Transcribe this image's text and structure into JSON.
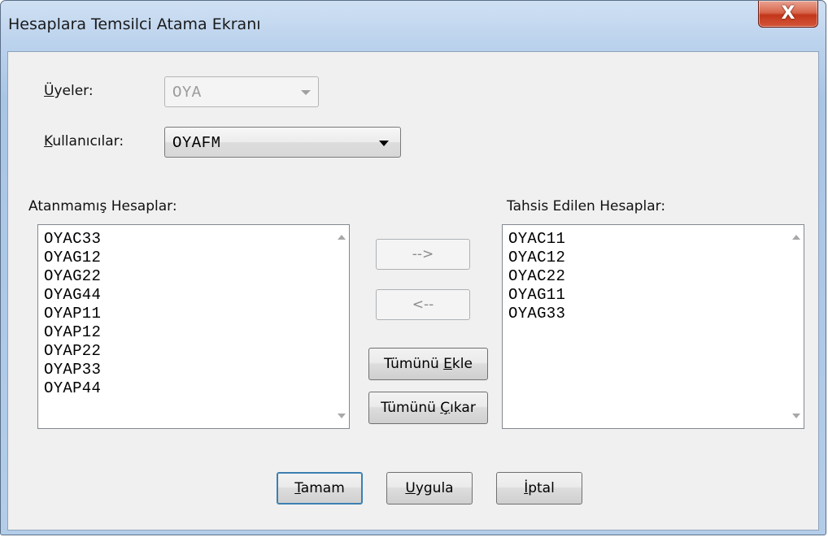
{
  "window": {
    "title": "Hesaplara Temsilci Atama Ekranı",
    "close_icon": "close-icon",
    "close_glyph": "X"
  },
  "members": {
    "label_u": "Ü",
    "label_rest": "yeler:",
    "value": "OYA",
    "enabled": false
  },
  "users": {
    "label_u": "K",
    "label_rest": "ullanıcılar:",
    "value": "OYAFM",
    "enabled": true
  },
  "unassigned": {
    "label": "Atanmamış Hesaplar:",
    "items": [
      "OYAC33",
      "OYAG12",
      "OYAG22",
      "OYAG44",
      "OYAP11",
      "OYAP12",
      "OYAP22",
      "OYAP33",
      "OYAP44"
    ]
  },
  "assigned": {
    "label": "Tahsis Edilen Hesaplar:",
    "items": [
      "OYAC11",
      "OYAC12",
      "OYAC22",
      "OYAG11",
      "OYAG33"
    ]
  },
  "transfer": {
    "add_label": "-->",
    "remove_label": "<--",
    "add_all_pre": "Tümünü ",
    "add_all_u": "E",
    "add_all_post": "kle",
    "remove_all_pre": "Tümünü ",
    "remove_all_u": "Ç",
    "remove_all_post": "ıkar"
  },
  "footer": {
    "ok_u": "T",
    "ok_rest": "amam",
    "apply_u": "U",
    "apply_rest": "ygula",
    "cancel_u": "İ",
    "cancel_rest": "ptal"
  }
}
